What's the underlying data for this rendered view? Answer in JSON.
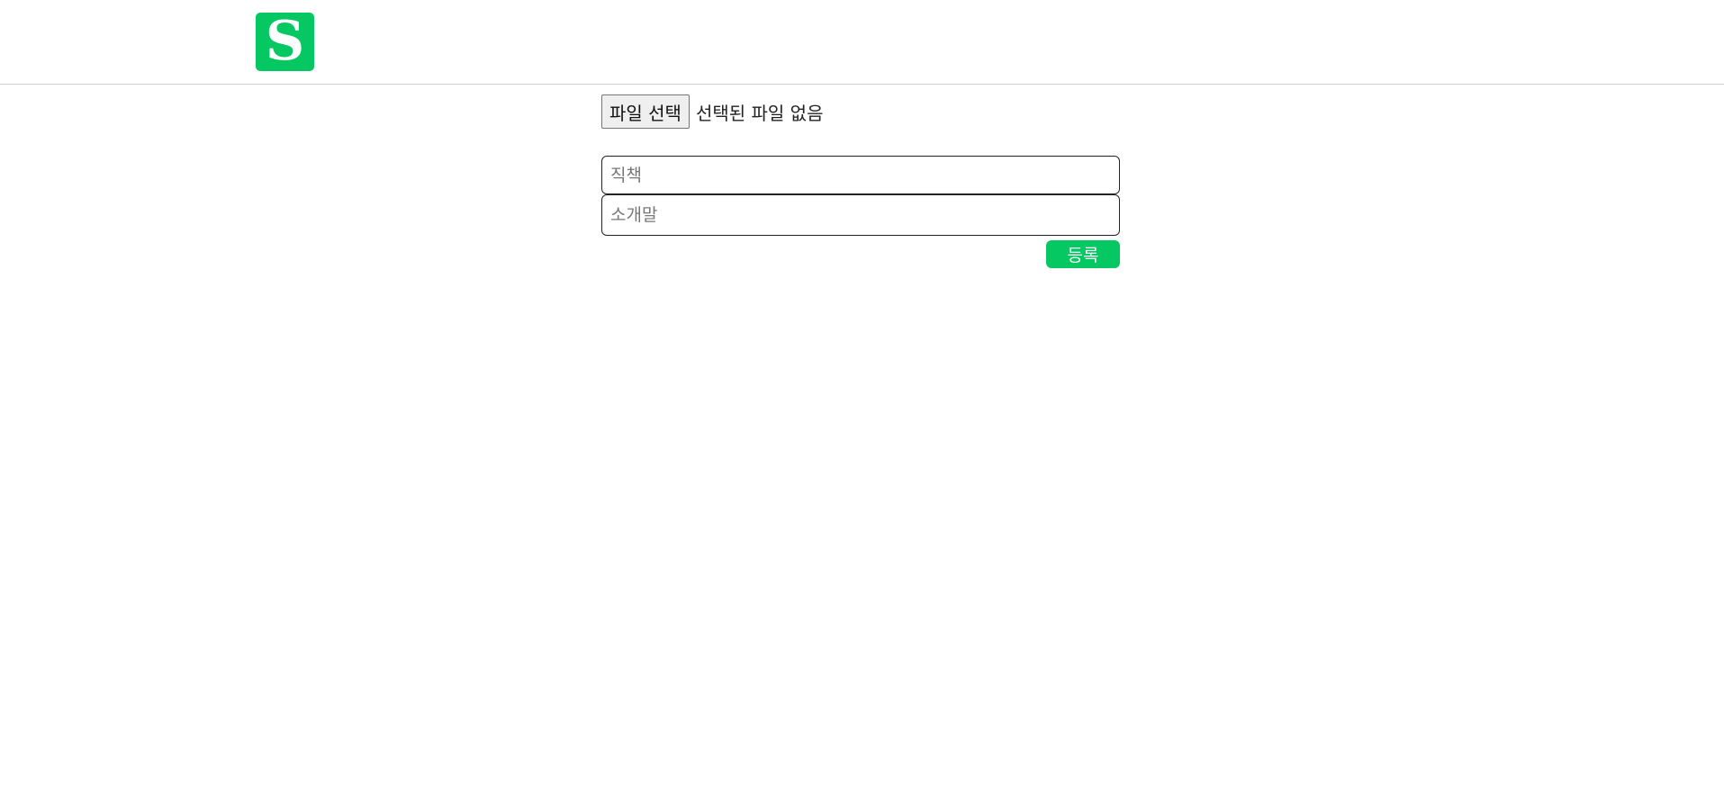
{
  "colors": {
    "brand": "#06c862",
    "divider": "#cfcfcf"
  },
  "header": {
    "logo_letter": "S",
    "logo_icon": "app-logo-icon"
  },
  "form": {
    "file_button_label": "파일 선택",
    "file_status": "선택된 파일 없음",
    "position_field": {
      "placeholder": "직책",
      "value": ""
    },
    "intro_field": {
      "placeholder": "소개말",
      "value": ""
    },
    "submit_label": "등록"
  }
}
